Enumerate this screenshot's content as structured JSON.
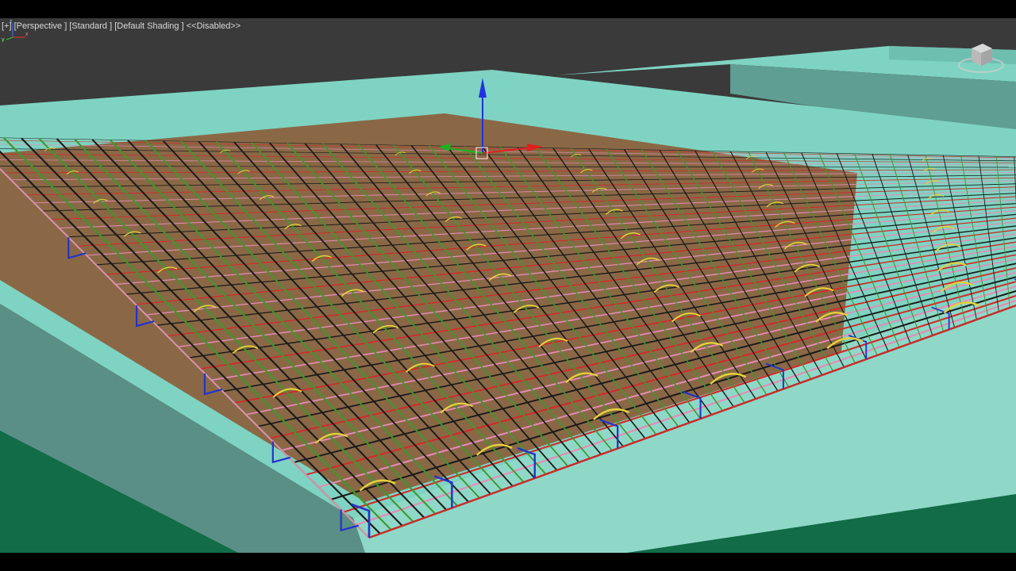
{
  "viewport": {
    "label": {
      "menu": "[+]",
      "view": "[Perspective ]",
      "mode": "[Standard ]",
      "shading": "[Default Shading ]",
      "status": "<<Disabled>>"
    },
    "viewcube_icon": "viewcube-icon",
    "axis_tripod": {
      "x": "x",
      "y": "y",
      "z": "z"
    }
  },
  "colors": {
    "background": "#3a3a3a",
    "slab": "#7fd3c2",
    "slab_side": "#5a8f86",
    "ground": "#126c47",
    "wood": "#8b5e3c",
    "rebar_red": "#d42828",
    "rebar_pink": "#e58bb5",
    "rebar_green": "#3a9a2a",
    "rebar_black": "#1a1a1a",
    "rebar_yellow": "#e6d23a",
    "stirrup_blue": "#2233cc",
    "gizmo_x": "#e02020",
    "gizmo_y": "#20b020",
    "gizmo_z": "#2030e0"
  }
}
